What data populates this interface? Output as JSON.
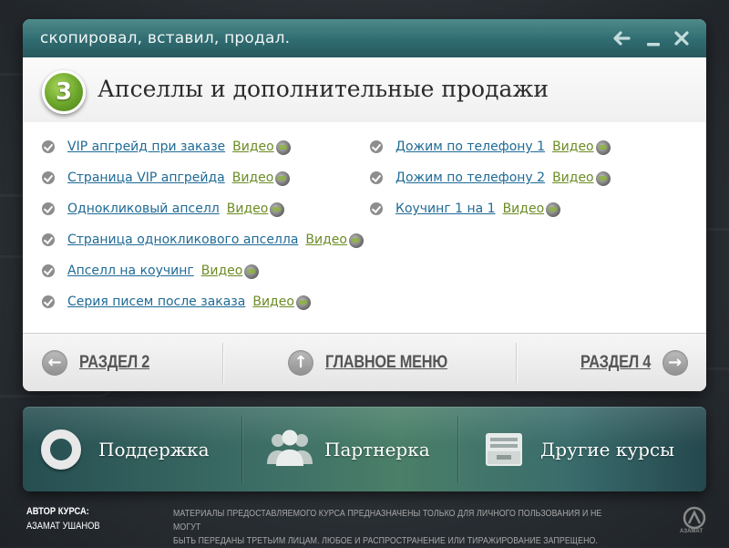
{
  "window": {
    "title": "скопировал, вставил, продал."
  },
  "header": {
    "step_number": "3",
    "title": "Апселлы и дополнительные продажи"
  },
  "lessons": {
    "left": [
      {
        "label": "VIP апгрейд при заказе",
        "video": "Видео"
      },
      {
        "label": "Страница VIP апгрейда",
        "video": "Видео"
      },
      {
        "label": "Однокликовый апселл",
        "video": "Видео"
      },
      {
        "label": "Страница однокликового апселла",
        "video": "Видео"
      },
      {
        "label": "Апселл на коучинг",
        "video": "Видео"
      },
      {
        "label": "Серия писем после заказа",
        "video": "Видео"
      }
    ],
    "right": [
      {
        "label": "Дожим по телефону 1",
        "video": "Видео"
      },
      {
        "label": "Дожим по телефону 2",
        "video": "Видео"
      },
      {
        "label": "Коучинг 1 на 1",
        "video": "Видео"
      }
    ]
  },
  "nav": {
    "prev": "РАЗДЕЛ 2",
    "menu": "ГЛАВНОЕ МЕНЮ",
    "next": "РАЗДЕЛ 4"
  },
  "panel": {
    "support": "Поддержка",
    "partner": "Партнерка",
    "courses": "Другие курсы"
  },
  "footer": {
    "author_label": "АВТОР КУРСА:",
    "author_name": "АЗАМАТ УШАНОВ",
    "notice_line1": "МАТЕРИАЛЫ ПРЕДОСТАВЛЯЕМОГО КУРСА ПРЕДНАЗНАЧЕНЫ ТОЛЬКО ДЛЯ ЛИЧНОГО ПОЛЬЗОВАНИЯ И НЕ МОГУТ",
    "notice_line2": "БЫТЬ ПЕРЕДАНЫ ТРЕТЬИМ ЛИЦАМ. ЛЮБОЕ И РАСПРОСТРАНЕНИЕ ИЛИ ТИРАЖИРОВАНИЕ ЗАПРЕЩЕНО.",
    "logo_text": "АЗАМАТ"
  },
  "colors": {
    "titlebar": "#2f6c71",
    "link": "#1f6a95",
    "video_link": "#6c8c25",
    "step_badge": "#6aa52a"
  },
  "icons": {
    "back": "arrow-left-icon",
    "minimize": "minimize-icon",
    "close": "close-icon",
    "check": "check-circle-icon",
    "video": "video-disc-icon",
    "nav_prev": "arrow-left-circle-icon",
    "nav_menu": "arrow-up-circle-icon",
    "nav_next": "arrow-right-circle-icon",
    "support": "lifebuoy-icon",
    "partner": "people-icon",
    "courses": "inbox-tray-icon"
  }
}
